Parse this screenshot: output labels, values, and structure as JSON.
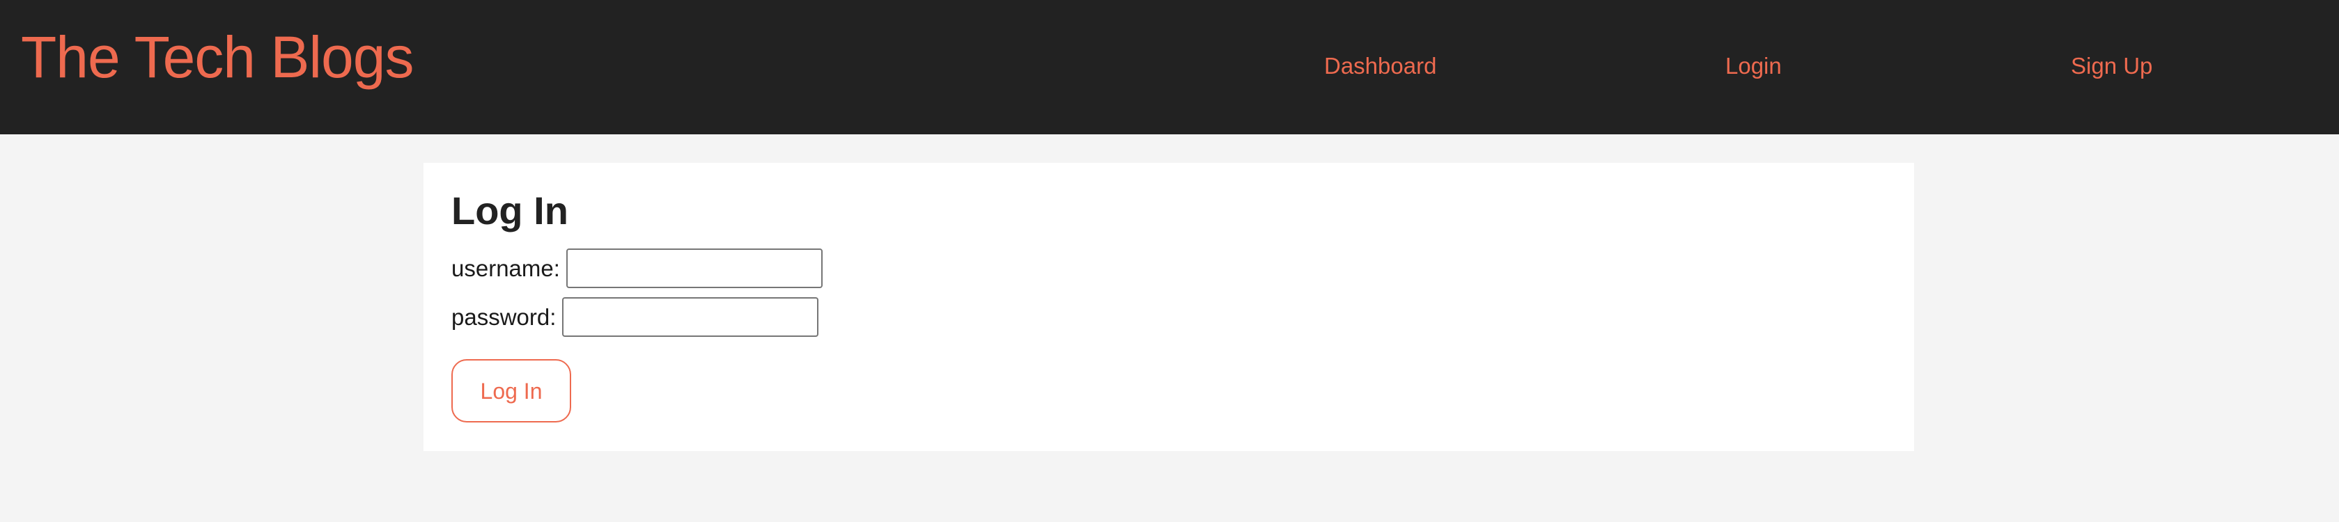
{
  "header": {
    "site_title": "The Tech Blogs",
    "nav": {
      "dashboard": "Dashboard",
      "login": "Login",
      "signup": "Sign Up"
    }
  },
  "login_form": {
    "title": "Log In",
    "username_label": "username:",
    "username_value": "",
    "password_label": "password:",
    "password_value": "",
    "submit_label": "Log In"
  },
  "colors": {
    "accent": "#ee6a4f",
    "header_background": "#222222",
    "page_background": "#f4f4f4",
    "card_background": "#ffffff"
  }
}
